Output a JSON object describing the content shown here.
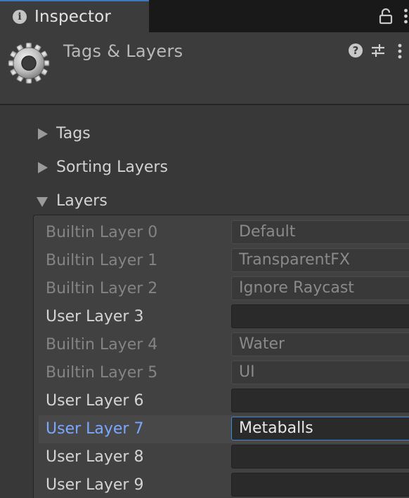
{
  "tab": {
    "title": "Inspector",
    "info_icon": "info-icon",
    "lock_icon": "lock-icon",
    "menu_icon": "kebab-menu-icon"
  },
  "header": {
    "title": "Tags & Layers",
    "icon": "gear-icon",
    "actions": [
      "help-icon",
      "presets-icon",
      "kebab-menu-icon"
    ]
  },
  "foldouts": {
    "tags": {
      "label": "Tags",
      "expanded": false
    },
    "sorting_layers": {
      "label": "Sorting Layers",
      "expanded": false
    },
    "layers": {
      "label": "Layers",
      "expanded": true
    }
  },
  "layers": [
    {
      "label": "Builtin Layer 0",
      "value": "Default",
      "builtin": true
    },
    {
      "label": "Builtin Layer 1",
      "value": "TransparentFX",
      "builtin": true
    },
    {
      "label": "Builtin Layer 2",
      "value": "Ignore Raycast",
      "builtin": true
    },
    {
      "label": "User Layer 3",
      "value": "",
      "builtin": false
    },
    {
      "label": "Builtin Layer 4",
      "value": "Water",
      "builtin": true
    },
    {
      "label": "Builtin Layer 5",
      "value": "UI",
      "builtin": true
    },
    {
      "label": "User Layer 6",
      "value": "",
      "builtin": false
    },
    {
      "label": "User Layer 7",
      "value": "Metaballs",
      "builtin": false,
      "selected": true
    },
    {
      "label": "User Layer 8",
      "value": "",
      "builtin": false
    },
    {
      "label": "User Layer 9",
      "value": "",
      "builtin": false
    }
  ],
  "colors": {
    "accent": "#3d86d8",
    "selected_label": "#7aa7ff",
    "panel": "#383838"
  }
}
